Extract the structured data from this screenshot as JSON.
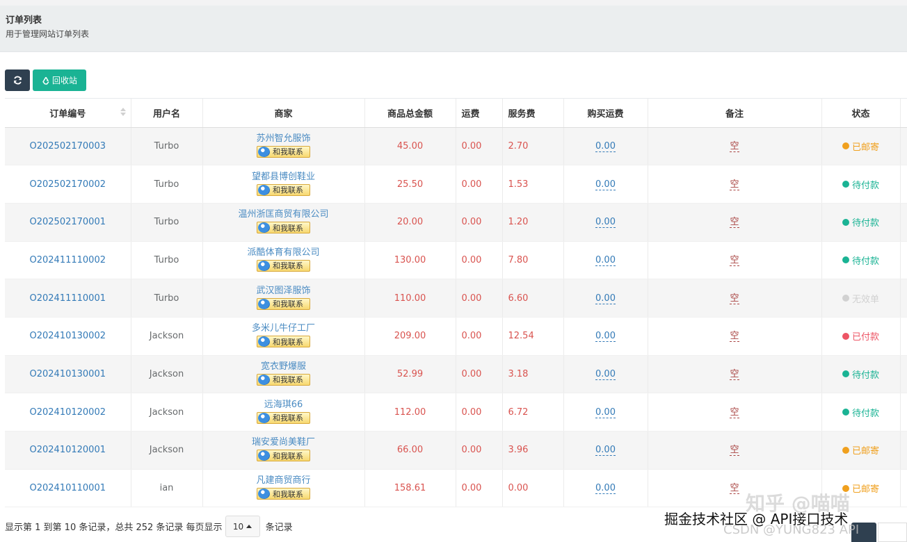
{
  "header": {
    "title": "订单列表",
    "subtitle": "用于管理网站订单列表"
  },
  "toolbar": {
    "refresh_icon": "refresh-icon",
    "recycle_label": "回收站",
    "recycle_icon": "recycle-icon"
  },
  "table": {
    "columns": [
      "订单编号",
      "用户名",
      "商家",
      "商品总金额",
      "运费",
      "服务费",
      "购买运费",
      "备注",
      "状态"
    ],
    "contact_label": "和我联系",
    "remark_placeholder": "空",
    "rows": [
      {
        "order_no": "O202502170003",
        "user": "Turbo",
        "shop": "苏州智允服饰",
        "total": "45.00",
        "shipping": "0.00",
        "service": "2.70",
        "buy_shipping": "0.00",
        "status": "已邮寄",
        "status_color": "#f0a01e"
      },
      {
        "order_no": "O202502170002",
        "user": "Turbo",
        "shop": "望都县博创鞋业",
        "total": "25.50",
        "shipping": "0.00",
        "service": "1.53",
        "buy_shipping": "0.00",
        "status": "待付款",
        "status_color": "#1ab394"
      },
      {
        "order_no": "O202502170001",
        "user": "Turbo",
        "shop": "温州浙匡商贸有限公司",
        "total": "20.00",
        "shipping": "0.00",
        "service": "1.20",
        "buy_shipping": "0.00",
        "status": "待付款",
        "status_color": "#1ab394"
      },
      {
        "order_no": "O202411110002",
        "user": "Turbo",
        "shop": "派酷体育有限公司",
        "total": "130.00",
        "shipping": "0.00",
        "service": "7.80",
        "buy_shipping": "0.00",
        "status": "待付款",
        "status_color": "#1ab394"
      },
      {
        "order_no": "O202411110001",
        "user": "Turbo",
        "shop": "武汉图泽服饰",
        "total": "110.00",
        "shipping": "0.00",
        "service": "6.60",
        "buy_shipping": "0.00",
        "status": "无效单",
        "status_color": "#d1d1d1"
      },
      {
        "order_no": "O202410130002",
        "user": "Jackson",
        "shop": "多米儿牛仔工厂",
        "total": "209.00",
        "shipping": "0.00",
        "service": "12.54",
        "buy_shipping": "0.00",
        "status": "已付款",
        "status_color": "#ed5565"
      },
      {
        "order_no": "O202410130001",
        "user": "Jackson",
        "shop": "宽衣野爆服",
        "total": "52.99",
        "shipping": "0.00",
        "service": "3.18",
        "buy_shipping": "0.00",
        "status": "待付款",
        "status_color": "#1ab394"
      },
      {
        "order_no": "O202410120002",
        "user": "Jackson",
        "shop": "远海琪66",
        "total": "112.00",
        "shipping": "0.00",
        "service": "6.72",
        "buy_shipping": "0.00",
        "status": "待付款",
        "status_color": "#1ab394"
      },
      {
        "order_no": "O202410120001",
        "user": "Jackson",
        "shop": "瑞安爱尚美鞋厂",
        "total": "66.00",
        "shipping": "0.00",
        "service": "3.96",
        "buy_shipping": "0.00",
        "status": "已邮寄",
        "status_color": "#f0a01e"
      },
      {
        "order_no": "O202410110001",
        "user": "ian",
        "shop": "凡建商贸商行",
        "total": "158.61",
        "shipping": "0.00",
        "service": "0.00",
        "buy_shipping": "0.00",
        "status": "已邮寄",
        "status_color": "#f0a01e"
      }
    ]
  },
  "footer": {
    "summary": "显示第 1 到第 10 条记录，总共 252 条记录 每页显示",
    "page_size": "10",
    "suffix": "条记录"
  },
  "watermarks": {
    "zhihu": "知乎 @喵喵",
    "juejin": "掘金技术社区 @ API接口技术",
    "csdn": "CSDN @YUNG823 API"
  }
}
